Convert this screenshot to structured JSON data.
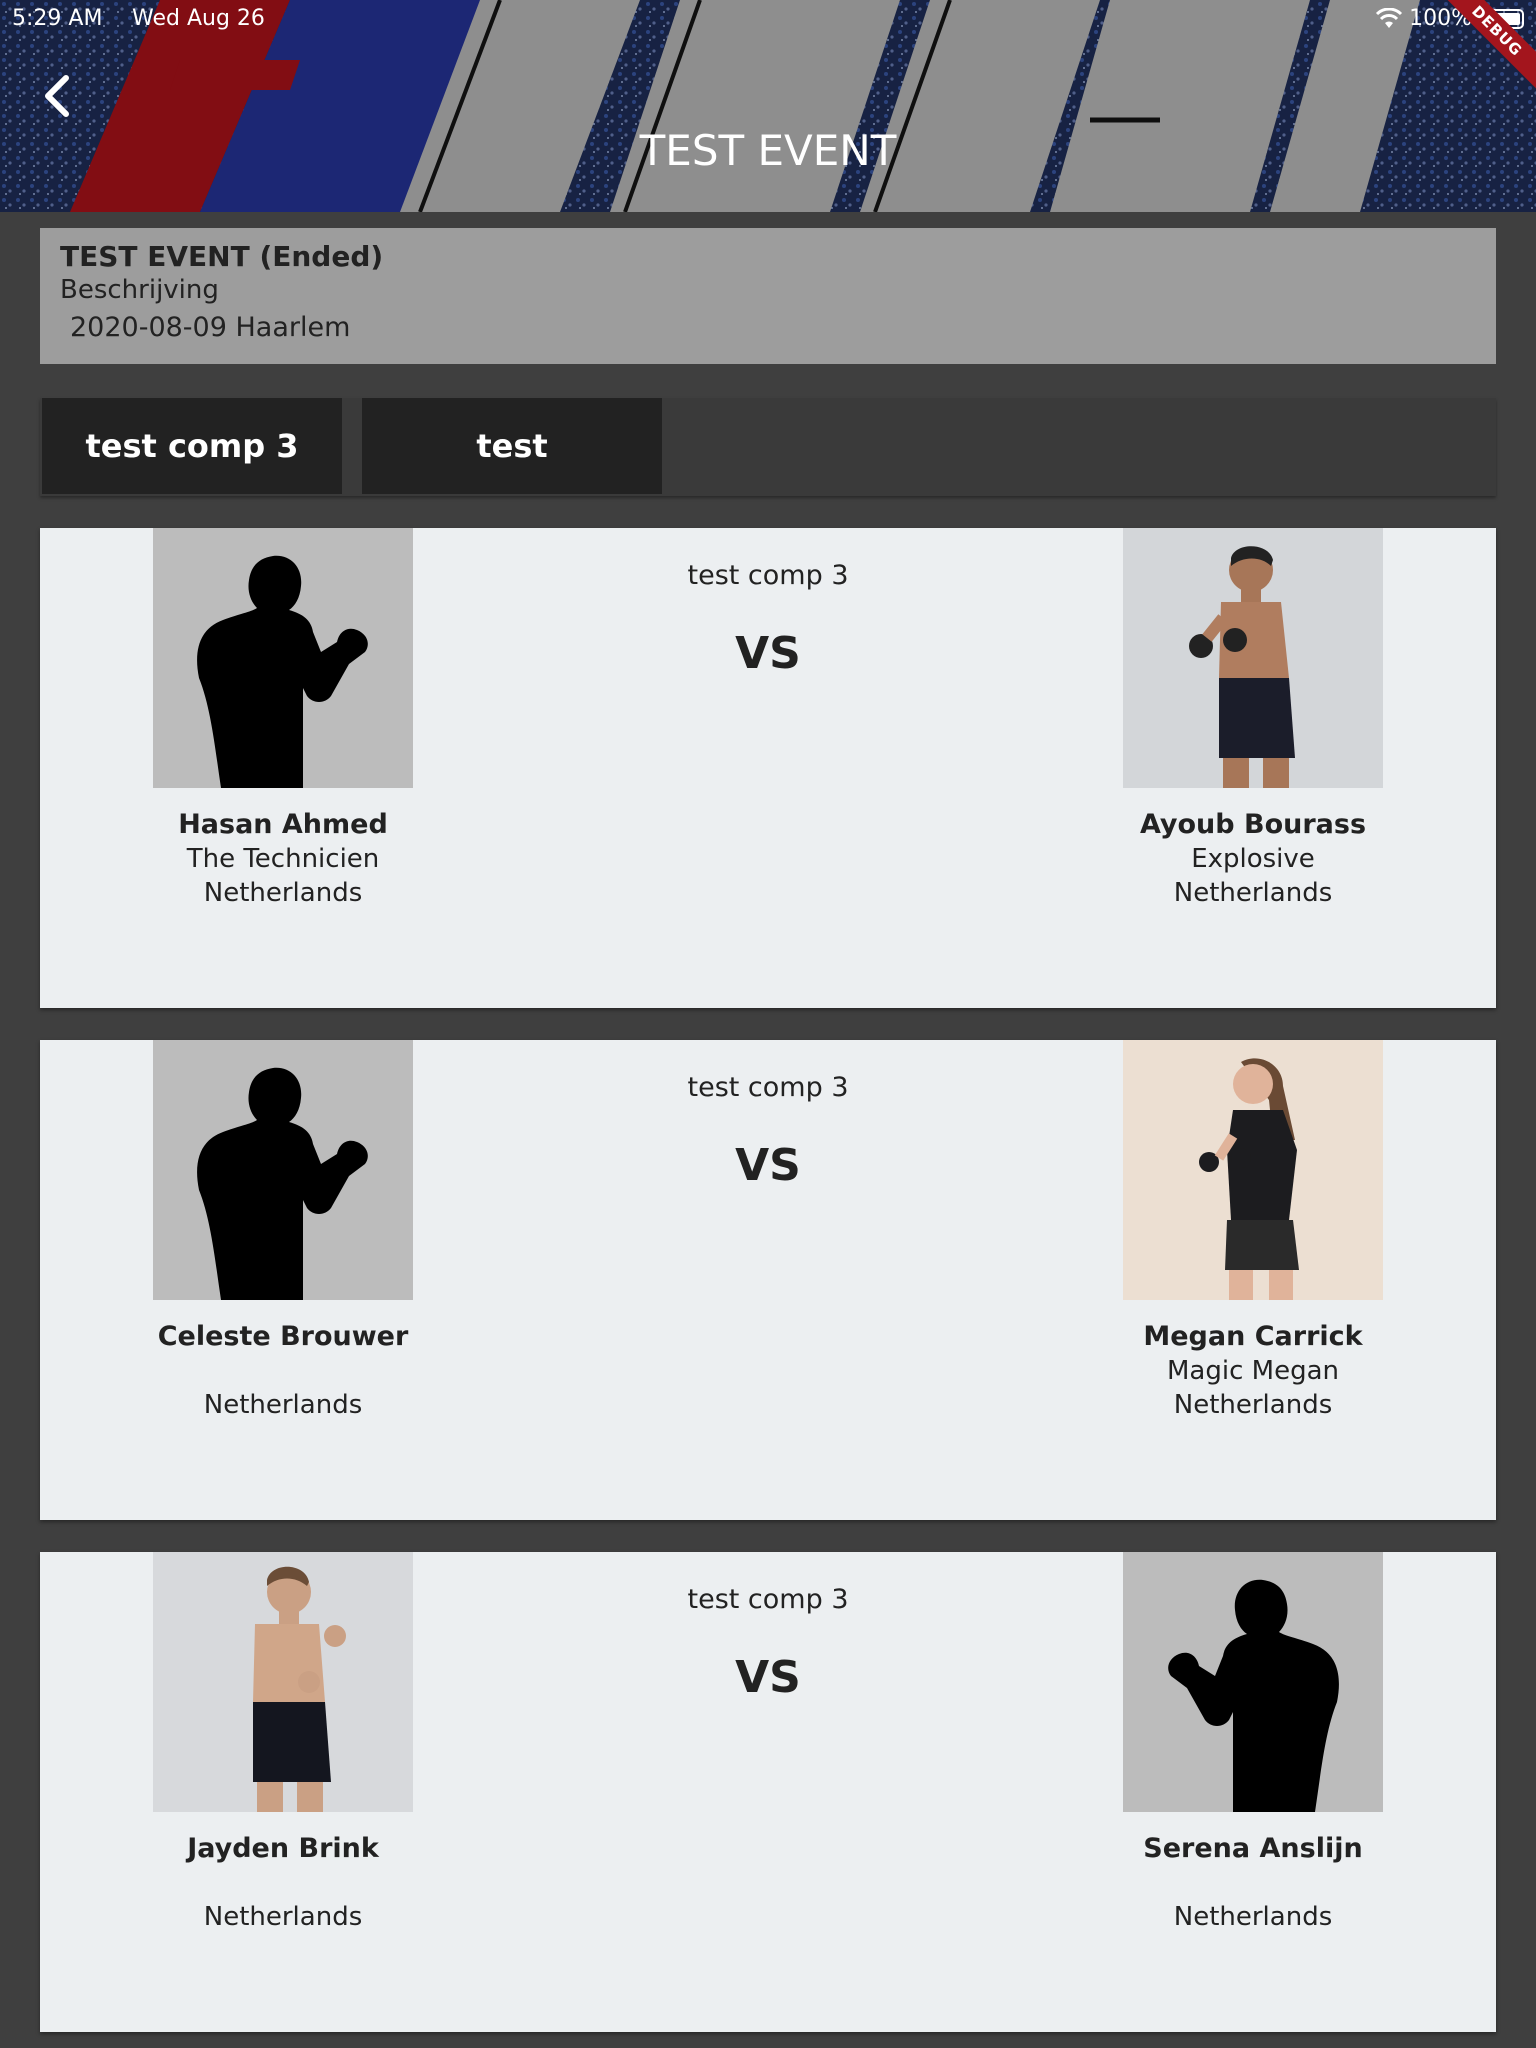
{
  "status_bar": {
    "time": "5:29 AM",
    "date": "Wed Aug 26",
    "battery": "100%"
  },
  "debug_banner": "DEBUG",
  "header": {
    "title": "TEST EVENT"
  },
  "event": {
    "name": "TEST EVENT (Ended)",
    "description": "Beschrijving",
    "date_location": "2020-08-09 Haarlem"
  },
  "tabs": [
    {
      "label": "test comp 3"
    },
    {
      "label": "test"
    }
  ],
  "fights": [
    {
      "competition": "test comp 3",
      "vs": "VS",
      "left": {
        "name": "Hasan Ahmed",
        "nickname": "The Technicien",
        "country": "Netherlands",
        "photo": "silhouette"
      },
      "right": {
        "name": "Ayoub Bourass",
        "nickname": "Explosive",
        "country": "Netherlands",
        "photo": "photo"
      }
    },
    {
      "competition": "test comp 3",
      "vs": "VS",
      "left": {
        "name": "Celeste Brouwer",
        "nickname": "",
        "country": "Netherlands",
        "photo": "silhouette"
      },
      "right": {
        "name": "Megan Carrick",
        "nickname": "Magic Megan",
        "country": "Netherlands",
        "photo": "photo"
      }
    },
    {
      "competition": "test comp 3",
      "vs": "VS",
      "left": {
        "name": "Jayden Brink",
        "nickname": "",
        "country": "Netherlands",
        "photo": "photo"
      },
      "right": {
        "name": "Serena Anslijn",
        "nickname": "",
        "country": "Netherlands",
        "photo": "silhouette"
      }
    }
  ],
  "colors": {
    "background": "#3f3f3f",
    "card": "#eceff1",
    "info_card": "#9d9d9d",
    "tab": "#222222",
    "brand_red": "#c0141c",
    "brand_blue": "#2a3f8f"
  }
}
